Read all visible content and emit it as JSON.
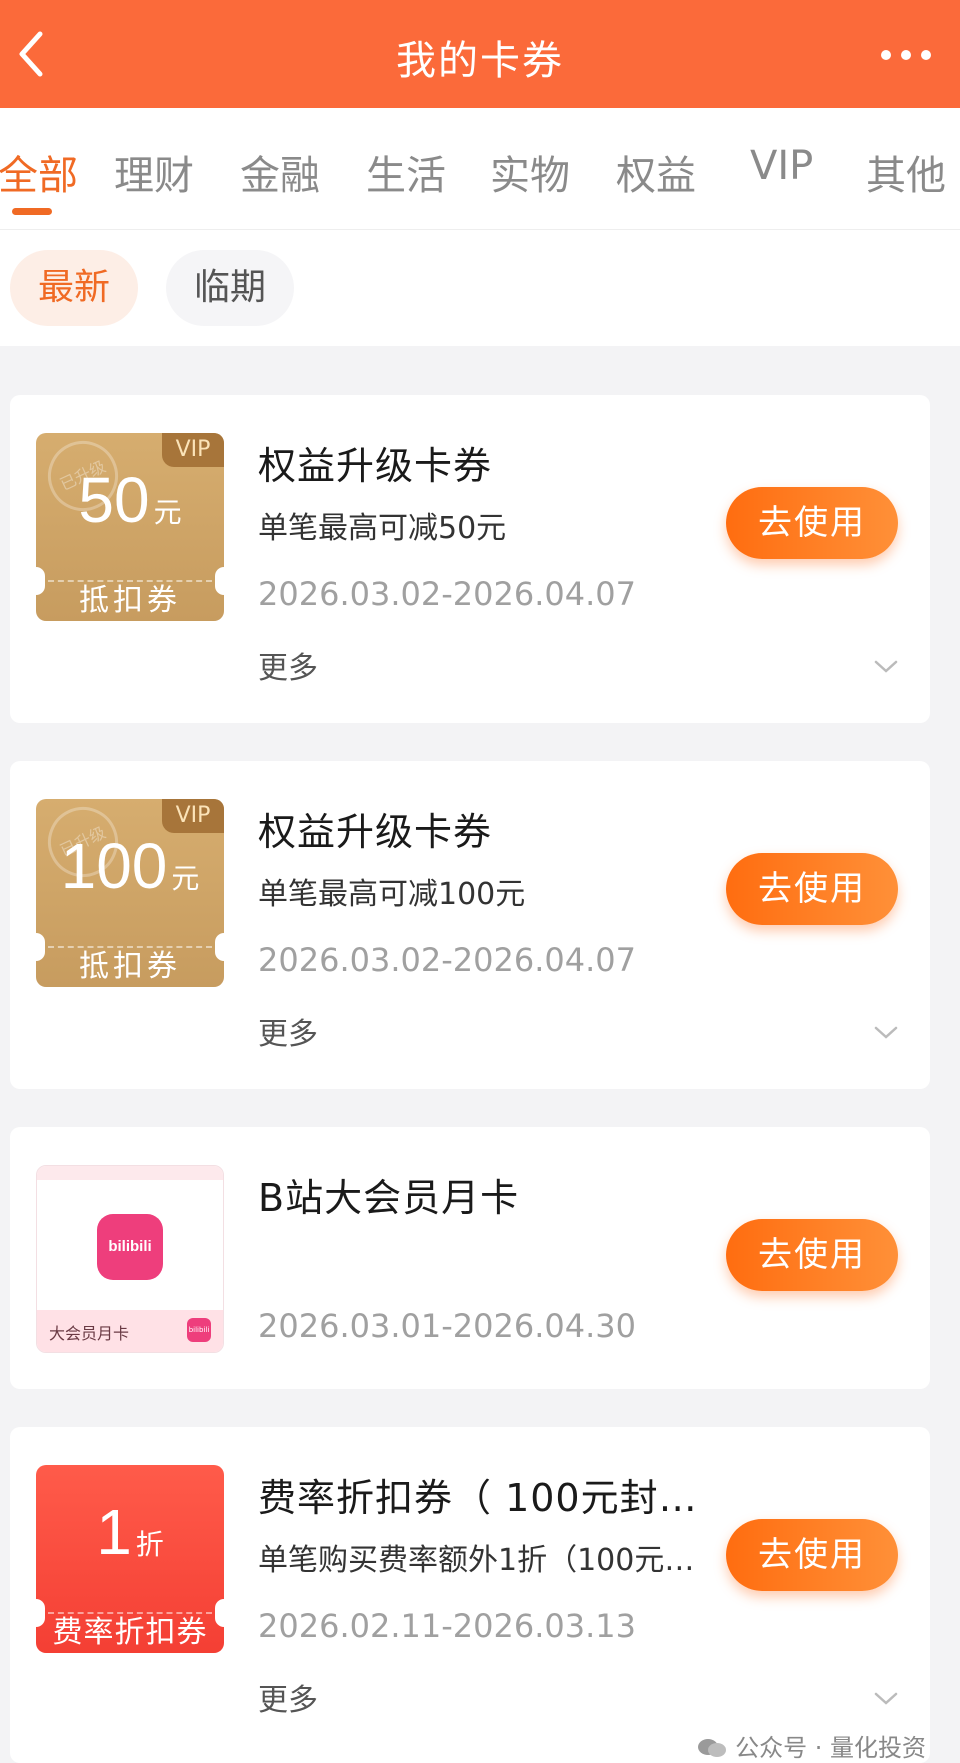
{
  "header": {
    "title": "我的卡券"
  },
  "tabs": [
    "全部",
    "理财",
    "金融",
    "生活",
    "实物",
    "权益",
    "VIP",
    "其他"
  ],
  "filters": [
    "最新",
    "临期"
  ],
  "coupons": [
    {
      "name": "权益升级卡券",
      "desc": "单笔最高可减50元",
      "date": "2026.03.02-2026.04.07",
      "more": "更多",
      "action": "去使用",
      "ticket": {
        "badge": "VIP",
        "stamp": "已升级",
        "amount": "50",
        "unit": "元",
        "label": "抵扣券"
      }
    },
    {
      "name": "权益升级卡券",
      "desc": "单笔最高可减100元",
      "date": "2026.03.02-2026.04.07",
      "more": "更多",
      "action": "去使用",
      "ticket": {
        "badge": "VIP",
        "stamp": "已升级",
        "amount": "100",
        "unit": "元",
        "label": "抵扣券"
      }
    },
    {
      "name": "B站大会员月卡",
      "date": "2026.03.01-2026.04.30",
      "action": "去使用",
      "ticket": {
        "logo_text": "bilibili",
        "bottom_text": "大会员月卡",
        "mini_logo": "bilibili"
      }
    },
    {
      "name": "费率折扣券（ 100元封…",
      "desc": "单笔购买费率额外1折（100元…",
      "date": "2026.02.11-2026.03.13",
      "more": "更多",
      "action": "去使用",
      "ticket": {
        "amount": "1",
        "unit": "折",
        "label": "费率折扣券"
      }
    }
  ],
  "watermark": "公众号 · 量化投资",
  "colors": {
    "brand": "#fb6a3a",
    "accent": "#f06a24",
    "button": "#ff7a1f",
    "gold": "#d1a86c",
    "red": "#f8483a"
  },
  "icons": {
    "back": "chevron-left-icon",
    "more": "more-dots-icon",
    "expand": "chevron-down-icon",
    "wechat": "wechat-icon"
  }
}
